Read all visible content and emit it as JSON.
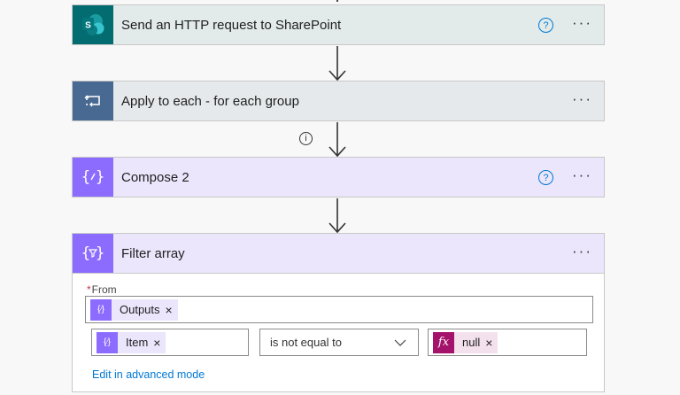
{
  "colors": {
    "sharepoint": "#036c70",
    "control": "#486991",
    "data_operation": "#8c6cff",
    "expression": "#a4126b",
    "link": "#0078d4"
  },
  "actions": [
    {
      "title": "Send an HTTP request to SharePoint",
      "icon": "sharepoint-icon",
      "has_help": true
    },
    {
      "title": "Apply to each - for each group",
      "icon": "loop-icon",
      "has_help": false
    },
    {
      "title": "Compose 2",
      "icon": "compose-icon",
      "has_help": true
    },
    {
      "title": "Filter array",
      "icon": "filter-array-icon",
      "has_help": false
    }
  ],
  "more_label": "···",
  "help_label": "?",
  "info_label": "i",
  "sharepoint_letter": "S",
  "filter": {
    "from_label": "From",
    "required_mark": "*",
    "from_token": {
      "label": "Outputs",
      "icon": "compose-token-icon"
    },
    "left_token": {
      "label": "Item",
      "icon": "filter-token-icon"
    },
    "operator": "is not equal to",
    "right_token": {
      "label": "null",
      "icon": "expression-fx-icon",
      "glyph": "fx"
    },
    "remove_label": "×",
    "advanced_link": "Edit in advanced mode"
  }
}
